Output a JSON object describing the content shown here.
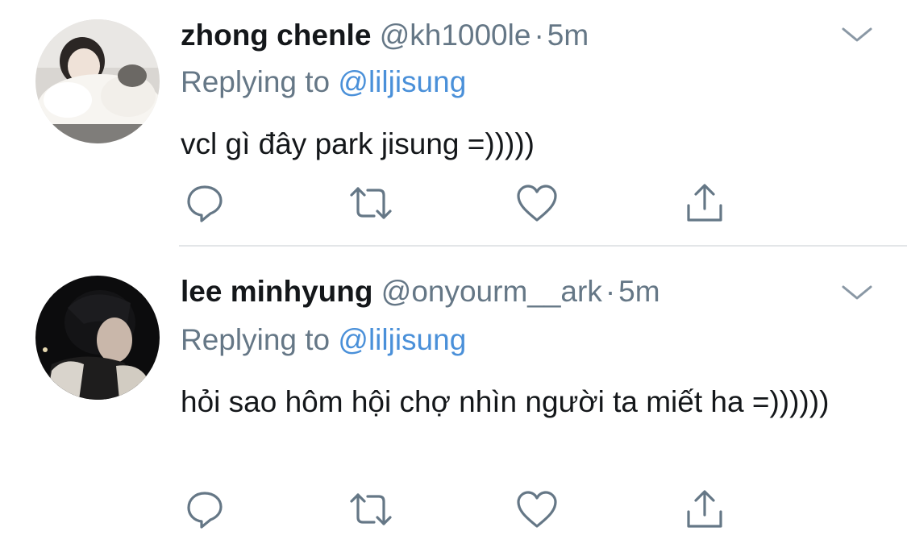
{
  "colors": {
    "text": "#14171a",
    "secondary": "#657786",
    "link": "#4a90d9",
    "icon": "#657786",
    "divider": "#e3e6e8"
  },
  "tweets": [
    {
      "display_name": "zhong chenle",
      "handle": "@kh1000le",
      "separator": "·",
      "time": "5m",
      "replying_label": "Replying to",
      "replying_to": "@liljisung",
      "text": "vcl gì đây park jisung =)))))",
      "avatar": "avatar-person-with-white-dog"
    },
    {
      "display_name": "lee minhyung",
      "handle": "@onyourm__ark",
      "separator": "·",
      "time": "5m",
      "replying_label": "Replying to",
      "replying_to": "@liljisung",
      "text": "hỏi sao hôm hội chợ nhìn người ta miết ha =))))))",
      "avatar": "avatar-person-dark-portrait"
    }
  ],
  "icons": {
    "reply": "reply-icon",
    "retweet": "retweet-icon",
    "like": "like-icon",
    "share": "share-icon",
    "more": "chevron-down-icon"
  }
}
